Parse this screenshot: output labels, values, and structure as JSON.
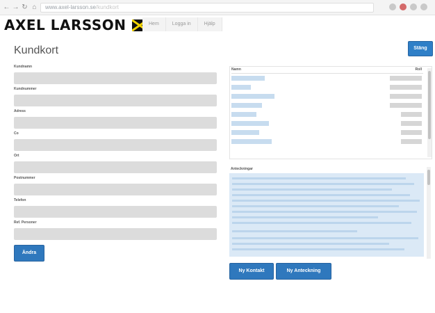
{
  "browser": {
    "url_text": "www.axel-larsson.se",
    "url_suffix": "/kundkort",
    "nav_icons": [
      "back-icon",
      "forward-icon",
      "reload-icon"
    ],
    "extension_icons": [
      "star-icon",
      "block-icon",
      "extension-icon",
      "menu-icon"
    ]
  },
  "brand": {
    "logo_text": "AXEL LARSSON"
  },
  "topnav": {
    "items": [
      "Hem",
      "Logga in",
      "Hjälp"
    ]
  },
  "stang_button": "Stäng",
  "page": {
    "title": "Kundkort"
  },
  "form": {
    "fields": [
      {
        "label": "Kundnamn",
        "value": ""
      },
      {
        "label": "Kundnummer",
        "value": ""
      },
      {
        "label": "Adress",
        "value": ""
      },
      {
        "label": "Co",
        "value": ""
      },
      {
        "label": "Ort",
        "value": ""
      },
      {
        "label": "Postnummer",
        "value": ""
      },
      {
        "label": "Telefon",
        "value": ""
      },
      {
        "label": "Ref. Personer",
        "value": ""
      }
    ],
    "save_button": "Ändra"
  },
  "contacts": {
    "col_name": "Namn",
    "col_note": "Roll",
    "row_count": 8
  },
  "notes": {
    "label": "Anteckningar"
  },
  "actions": {
    "new_contact": "Ny Kontakt",
    "new_note": "Ny Anteckning"
  },
  "colors": {
    "accent": "#2f78bd",
    "field_bg": "#dcdcdc",
    "list_name": "#c7dcef"
  }
}
